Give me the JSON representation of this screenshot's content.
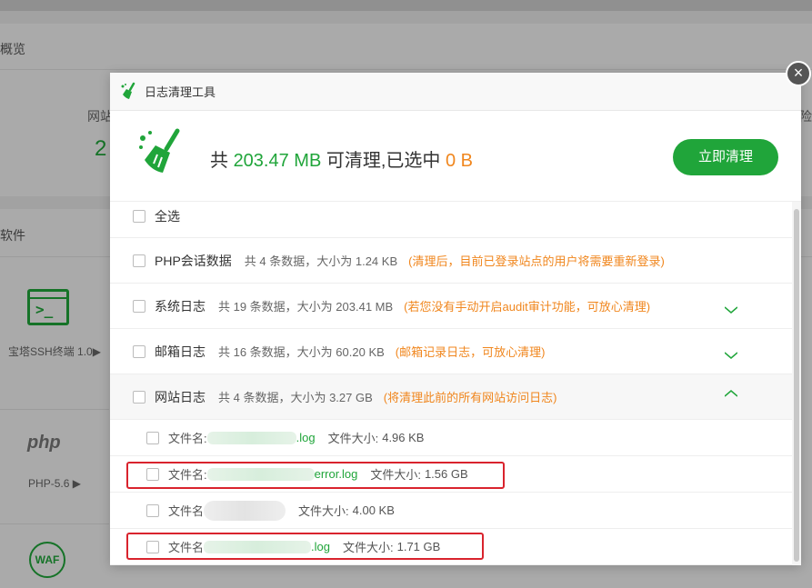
{
  "background": {
    "overview_label": "概览",
    "site_label": "网站",
    "stat_value": "2",
    "right_cut_label": "险",
    "software_label": "软件",
    "ssh_label": "宝塔SSH终端 1.0▶",
    "php_logo": "php",
    "php_label": "PHP-5.6 ▶",
    "waf_label": "WAF"
  },
  "dialog": {
    "title": "日志清理工具",
    "close_glyph": "×",
    "summary": {
      "prefix": "共",
      "total": "203.47 MB",
      "middle": "可清理,已选中",
      "selected": "0 B"
    },
    "clean_button": "立即清理",
    "select_all": "全选",
    "categories": [
      {
        "name": "PHP会话数据",
        "meta": "共 4 条数据，大小为 1.24 KB",
        "note": "(清理后，目前已登录站点的用户将需要重新登录)",
        "chevron": "none"
      },
      {
        "name": "系统日志",
        "meta": "共 19 条数据，大小为 203.41 MB",
        "note": "(若您没有手动开启audit审计功能，可放心清理)",
        "chevron": "down"
      },
      {
        "name": "邮箱日志",
        "meta": "共 16 条数据，大小为 60.20 KB",
        "note": "(邮箱记录日志，可放心清理)",
        "chevron": "down"
      },
      {
        "name": "网站日志",
        "meta": "共 4 条数据，大小为 3.27 GB",
        "note": "(将清理此前的所有网站访问日志)",
        "chevron": "up"
      }
    ],
    "files": [
      {
        "label": "文件名:",
        "suffix": ".log",
        "size_label": "文件大小:",
        "size": "4.96 KB"
      },
      {
        "label": "文件名:",
        "suffix": "error.log",
        "size_label": "文件大小:",
        "size": "1.56 GB"
      },
      {
        "label": "文件名",
        "suffix": "",
        "size_label": "文件大小:",
        "size": "4.00 KB"
      },
      {
        "label": "文件名",
        "suffix": ".log",
        "size_label": "文件大小:",
        "size": "1.71 GB"
      }
    ]
  },
  "colors": {
    "accent_green": "#20a53a",
    "note_orange": "#f0861d",
    "highlight_red": "#d9232d"
  }
}
